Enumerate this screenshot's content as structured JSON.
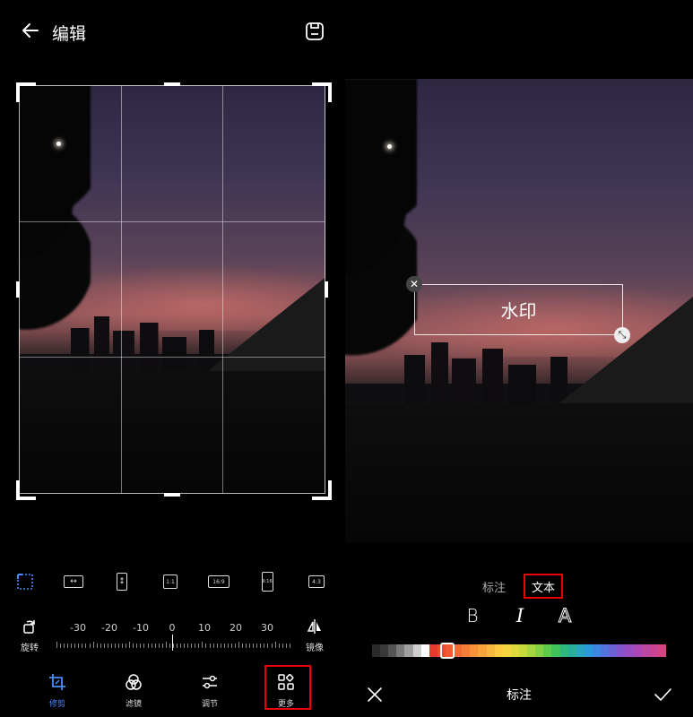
{
  "header": {
    "title": "编辑",
    "back_icon": "arrow-left-icon",
    "save_icon": "save-icon"
  },
  "crop": {
    "ratios": [
      {
        "id": "free",
        "label": "",
        "icon": "free-crop-icon",
        "active": true
      },
      {
        "id": "horizontal",
        "label": "",
        "icon": "horizontal-flip-ratio-icon"
      },
      {
        "id": "vertical",
        "label": "",
        "icon": "vertical-ratio-icon"
      },
      {
        "id": "1-1",
        "label": "1:1"
      },
      {
        "id": "16-9",
        "label": "16:9"
      },
      {
        "id": "9-16",
        "label": "9:16"
      },
      {
        "id": "4-3",
        "label": "4:3"
      }
    ],
    "rotate_label": "旋转",
    "mirror_label": "镜像",
    "angle_scale": [
      "-30",
      "-20",
      "-10",
      "0",
      "10",
      "20",
      "30"
    ],
    "angle_value": 0
  },
  "nav": [
    {
      "label": "修剪",
      "icon": "crop-icon",
      "active": true
    },
    {
      "label": "滤镜",
      "icon": "filter-icon"
    },
    {
      "label": "调节",
      "icon": "adjust-icon"
    },
    {
      "label": "更多",
      "icon": "more-grid-icon",
      "highlighted": true
    }
  ],
  "watermark": {
    "text": "水印",
    "tabs": [
      {
        "label": "标注"
      },
      {
        "label": "文本",
        "active": true,
        "highlighted": true
      }
    ],
    "styles": [
      {
        "label": "B",
        "name": "bold"
      },
      {
        "label": "I",
        "name": "italic"
      },
      {
        "label": "A",
        "name": "outline"
      }
    ],
    "palette": [
      "#2b2b2b",
      "#3a3a3a",
      "#555555",
      "#7a7a7a",
      "#a0a0a0",
      "#cfcfcf",
      "#ffffff",
      "#e8392f",
      "#ef4a32",
      "#f25a34",
      "#f36c36",
      "#f57f38",
      "#f7923a",
      "#f9a43d",
      "#fbb740",
      "#fdca42",
      "#f5d43f",
      "#dfd83c",
      "#c5d93c",
      "#a6d73f",
      "#84d243",
      "#5fcb4b",
      "#3fc25a",
      "#2fb87b",
      "#2aae9c",
      "#29a4be",
      "#2b98da",
      "#3d86e0",
      "#5373de",
      "#6c62d8",
      "#8455cf",
      "#9a4cc3",
      "#ad47b5",
      "#bd45a4",
      "#c94593",
      "#d34682"
    ],
    "palette_selected": 6,
    "bottom_title": "标注",
    "cancel_icon": "close-icon",
    "confirm_icon": "check-icon"
  },
  "colors": {
    "accent": "#4d8cff",
    "highlight": "#e00000"
  }
}
